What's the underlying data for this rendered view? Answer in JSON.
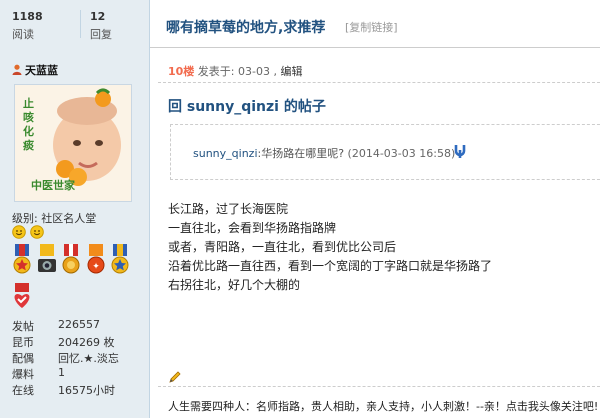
{
  "stats": {
    "views_count": "1188",
    "views_label": "阅读",
    "replies_count": "12",
    "replies_label": "回复"
  },
  "thread": {
    "title": "哪有摘草莓的地方,求推荐",
    "copy_link": "[复制链接]"
  },
  "user": {
    "name": "天蓝蓝",
    "avatar_text": "止咳化痰",
    "avatar_caption": "中医世家",
    "level_label": "级别: ",
    "level_value": "社区名人堂",
    "info": [
      {
        "key": "发帖",
        "value": "226557"
      },
      {
        "key": "昆币",
        "value": "204269 枚"
      },
      {
        "key": "配偶",
        "value": "回忆.★.淡忘"
      },
      {
        "key": "爆料",
        "value": "1"
      },
      {
        "key": "在线",
        "value": "16575小时"
      }
    ]
  },
  "post": {
    "floor": "10楼",
    "posted_at": " 发表于: 03-03 , ",
    "edit_label": "编辑",
    "reply_title": "回 sunny_qinzi 的帖子",
    "quote_user": "sunny_qinzi",
    "quote_text": ":华扬路在哪里呢? ",
    "quote_date": "(2014-03-03 16:58)",
    "body_lines": [
      "长江路，过了长海医院",
      "一直往北，会看到华扬路指路牌",
      "或者，青阳路，一直往北，看到优比公司后",
      "沿着优比路一直往西，看到一个宽阔的丁字路口就是华扬路了",
      "右拐往北，好几个大棚的"
    ],
    "signature": "人生需要四种人：名师指路，贵人相助，亲人支持，小人刺激！--亲！点击我头像关注吧!"
  },
  "colors": {
    "sidebar_bg": "#e5edf2",
    "title_blue": "#225280",
    "floor_orange": "#f26c4f"
  },
  "icons": [
    "user-icon",
    "smiley-icon",
    "medal-icon",
    "camera-icon",
    "quote-jump-icon",
    "pencil-icon",
    "heart-medal-icon"
  ]
}
